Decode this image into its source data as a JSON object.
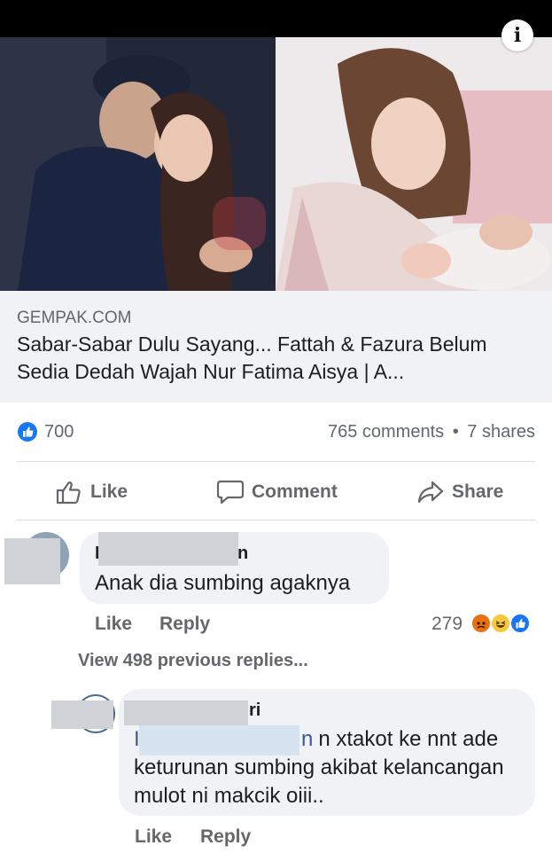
{
  "post": {
    "info_icon": "i",
    "link_domain": "GEMPAK.COM",
    "link_title": "Sabar-Sabar Dulu Sayang... Fattah & Fazura Belum Sedia Dedah Wajah Nur Fatima Aisya | A..."
  },
  "stats": {
    "likes": "700",
    "comments": "765 comments",
    "separator": "•",
    "shares": "7 shares"
  },
  "actions": {
    "like": "Like",
    "comment": "Comment",
    "share": "Share"
  },
  "comment1": {
    "author_start": "I",
    "author_end": "n",
    "text": "Anak dia sumbing agaknya",
    "like": "Like",
    "reply": "Reply",
    "reaction_count": "279",
    "reactions": [
      "angry-face-icon",
      "laughing-face-icon",
      "like-icon"
    ],
    "view_more": "View 498 previous replies..."
  },
  "reply1": {
    "author_end": "ri",
    "mention_start": "I",
    "text_start": "n xtakot ke nnt ade",
    "text_rest": "keturunan sumbing akibat kelancangan mulot ni makcik oiii..",
    "like": "Like",
    "reply": "Reply"
  },
  "colors": {
    "brand": "#1877f2",
    "bubble": "#f0f2f5",
    "muted": "#65676b"
  }
}
